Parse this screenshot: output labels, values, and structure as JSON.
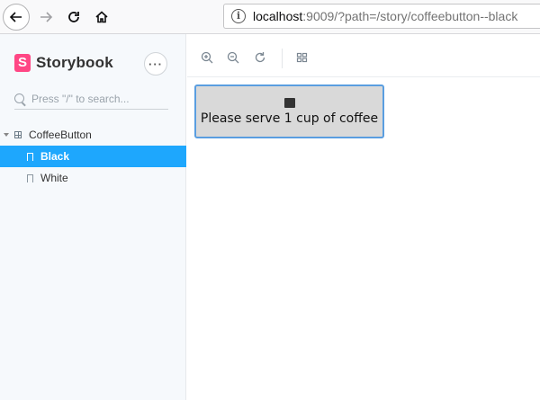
{
  "browser": {
    "url_host": "localhost",
    "url_rest": ":9009/?path=/story/coffeebutton--black"
  },
  "sidebar": {
    "brand": "Storybook",
    "brand_letter": "S",
    "menu_label": "···",
    "search_placeholder": "Press \"/\" to search...",
    "tree": {
      "component": "CoffeeButton",
      "stories": [
        {
          "label": "Black",
          "active": true
        },
        {
          "label": "White",
          "active": false
        }
      ]
    }
  },
  "toolbar": {
    "icons": [
      "zoom-in-icon",
      "zoom-out-icon",
      "reset-zoom-icon",
      "grid-icon"
    ]
  },
  "preview": {
    "button_label": "Please serve 1 cup of coffee",
    "button_glyph": "coffee-icon"
  },
  "colors": {
    "accent": "#1ea7fd",
    "brand": "#ff4785",
    "button_bg": "#d9d9d9",
    "button_border": "#5a9ee0"
  }
}
